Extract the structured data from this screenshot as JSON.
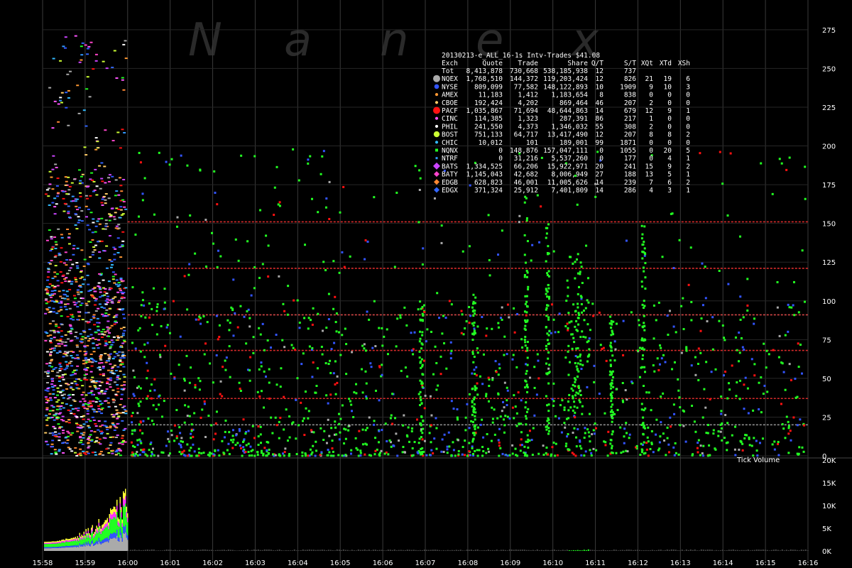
{
  "chart_data": {
    "type": "scatter",
    "title": "20130213-e_ALL_16-1s Intv-Trades $41.08",
    "watermark": "Nanex",
    "x_ticks": [
      "15:58",
      "15:59",
      "16:00",
      "16:01",
      "16:02",
      "16:03",
      "16:04",
      "16:05",
      "16:06",
      "16:07",
      "16:08",
      "16:09",
      "16:10",
      "16:11",
      "16:12",
      "16:13",
      "16:14",
      "16:15",
      "16:16"
    ],
    "y_ticks": [
      "0",
      "25",
      "50",
      "75",
      "100",
      "125",
      "150",
      "175",
      "200",
      "225",
      "250",
      "275"
    ],
    "ylim": [
      0,
      285
    ],
    "volume_label": "Tick Volume",
    "volume_ticks": [
      "0K",
      "5K",
      "10K",
      "15K",
      "20K"
    ],
    "volume_ylim": [
      0,
      20000
    ],
    "price_levels": [
      {
        "value": 151,
        "color": "#ff3333"
      },
      {
        "value": 121,
        "color": "#ff3333"
      },
      {
        "value": 91,
        "color": "#ff5555"
      },
      {
        "value": 68,
        "color": "#ff3333"
      },
      {
        "value": 37,
        "color": "#ff3333"
      },
      {
        "value": 20,
        "color": "#aaaaaa"
      }
    ],
    "columns": [
      "Exch",
      "Quote",
      "Trade",
      "Share",
      "Q/T",
      "S/T",
      "XQt",
      "XTd",
      "XSh"
    ],
    "total": {
      "exch": "Tot",
      "quote": "8,413,878",
      "trade": "730,668",
      "share": "538,185,938",
      "qt": "12",
      "st": "737",
      "xqt": "",
      "xtd": "",
      "xsh": ""
    },
    "exchanges": [
      {
        "exch": "NQEX",
        "color": "#aaaaaa",
        "shape": "circle",
        "size": 6,
        "quote": "1,768,510",
        "trade": "144,372",
        "share": "119,203,424",
        "qt": "12",
        "st": "826",
        "xqt": "21",
        "xtd": "19",
        "xsh": "6"
      },
      {
        "exch": "NYSE",
        "color": "#3355ff",
        "shape": "circle",
        "size": 4,
        "quote": "809,099",
        "trade": "77,582",
        "share": "148,122,893",
        "qt": "10",
        "st": "1909",
        "xqt": "9",
        "xtd": "10",
        "xsh": "3"
      },
      {
        "exch": "AMEX",
        "color": "#ff9933",
        "shape": "circle",
        "size": 2.5,
        "quote": "11,183",
        "trade": "1,412",
        "share": "1,183,654",
        "qt": "8",
        "st": "838",
        "xqt": "0",
        "xtd": "0",
        "xsh": "0"
      },
      {
        "exch": "CBOE",
        "color": "#ffcc66",
        "shape": "circle",
        "size": 2.5,
        "quote": "192,424",
        "trade": "4,202",
        "share": "869,464",
        "qt": "46",
        "st": "207",
        "xqt": "2",
        "xtd": "0",
        "xsh": "0"
      },
      {
        "exch": "PACF",
        "color": "#ff1111",
        "shape": "circle",
        "size": 6,
        "quote": "1,035,867",
        "trade": "71,694",
        "share": "48,644,863",
        "qt": "14",
        "st": "679",
        "xqt": "12",
        "xtd": "9",
        "xsh": "1"
      },
      {
        "exch": "CINC",
        "color": "#ff55ff",
        "shape": "circle",
        "size": 2.5,
        "quote": "114,385",
        "trade": "1,323",
        "share": "287,391",
        "qt": "86",
        "st": "217",
        "xqt": "1",
        "xtd": "0",
        "xsh": "0"
      },
      {
        "exch": "PHIL",
        "color": "#ffffff",
        "shape": "circle",
        "size": 2.5,
        "quote": "241,550",
        "trade": "4,373",
        "share": "1,346,032",
        "qt": "55",
        "st": "308",
        "xqt": "2",
        "xtd": "0",
        "xsh": "0"
      },
      {
        "exch": "BOST",
        "color": "#ccff33",
        "shape": "circle",
        "size": 5,
        "quote": "751,133",
        "trade": "64,717",
        "share": "13,417,490",
        "qt": "12",
        "st": "207",
        "xqt": "8",
        "xtd": "8",
        "xsh": "2"
      },
      {
        "exch": "CHIC",
        "color": "#33bbff",
        "shape": "circle",
        "size": 2.5,
        "quote": "10,012",
        "trade": "101",
        "share": "189,001",
        "qt": "99",
        "st": "1871",
        "xqt": "0",
        "xtd": "0",
        "xsh": "0"
      },
      {
        "exch": "NQNX",
        "color": "#22ff22",
        "shape": "square",
        "size": 4,
        "quote": "0",
        "trade": "148,876",
        "share": "157,047,111",
        "qt": "0",
        "st": "1055",
        "xqt": "0",
        "xtd": "20",
        "xsh": "5"
      },
      {
        "exch": "NTRF",
        "color": "#3399ff",
        "shape": "square",
        "size": 3,
        "quote": "0",
        "trade": "31,216",
        "share": "5,537,260",
        "qt": "0",
        "st": "177",
        "xqt": "0",
        "xtd": "4",
        "xsh": "1"
      },
      {
        "exch": "BATS",
        "color": "#cc44ff",
        "shape": "diamond",
        "size": 5,
        "quote": "1,334,525",
        "trade": "66,206",
        "share": "15,922,971",
        "qt": "20",
        "st": "241",
        "xqt": "15",
        "xtd": "9",
        "xsh": "2"
      },
      {
        "exch": "BATY",
        "color": "#ff44cc",
        "shape": "diamond",
        "size": 4,
        "quote": "1,145,043",
        "trade": "42,682",
        "share": "8,006,949",
        "qt": "27",
        "st": "188",
        "xqt": "13",
        "xtd": "5",
        "xsh": "1"
      },
      {
        "exch": "EDGB",
        "color": "#ff8833",
        "shape": "diamond",
        "size": 4,
        "quote": "628,823",
        "trade": "46,001",
        "share": "11,005,626",
        "qt": "14",
        "st": "239",
        "xqt": "7",
        "xtd": "6",
        "xsh": "2"
      },
      {
        "exch": "EDGX",
        "color": "#3366ff",
        "shape": "diamond",
        "size": 4,
        "quote": "371,324",
        "trade": "25,912",
        "share": "7,401,809",
        "qt": "14",
        "st": "286",
        "xqt": "4",
        "xtd": "3",
        "xsh": "1"
      }
    ]
  }
}
